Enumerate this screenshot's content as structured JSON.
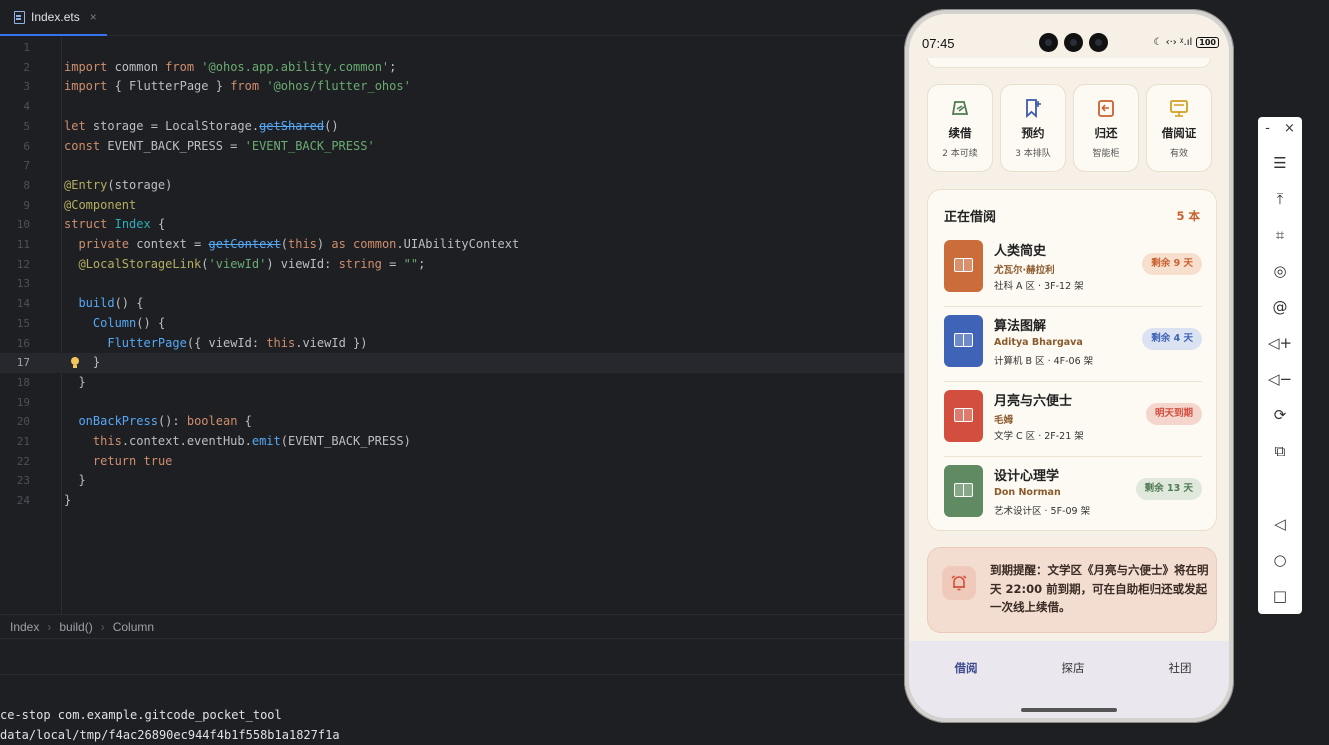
{
  "editor": {
    "tab_label": "Index.ets",
    "tab_close": "×",
    "current_line": 17,
    "lines": [
      {
        "n": "1",
        "html": ""
      },
      {
        "n": "2",
        "html": "<span class='kw'>import</span> common <span class='kw'>from</span> <span class='str'>'@ohos.app.ability.common'</span>;"
      },
      {
        "n": "3",
        "html": "<span class='kw'>import</span> { FlutterPage } <span class='kw'>from</span> <span class='str'>'@ohos/flutter_ohos'</span>"
      },
      {
        "n": "4",
        "html": ""
      },
      {
        "n": "5",
        "html": "<span class='kw'>let</span> storage = LocalStorage.<span class='dep'>getShared</span>()"
      },
      {
        "n": "6",
        "html": "<span class='kw'>const</span> EVENT_BACK_PRESS = <span class='str'>'EVENT_BACK_PRESS'</span>"
      },
      {
        "n": "7",
        "html": ""
      },
      {
        "n": "8",
        "html": "<span class='an'>@Entry</span>(storage)"
      },
      {
        "n": "9",
        "html": "<span class='an'>@Component</span>"
      },
      {
        "n": "10",
        "html": "<span class='kw'>struct</span> <span class='ty'>Index</span> {"
      },
      {
        "n": "11",
        "html": "  <span class='kw'>private</span> context = <span class='dep'>getContext</span>(<span class='kw'>this</span>) <span class='kw'>as</span> <span class='kw'>common</span>.UIAbilityContext"
      },
      {
        "n": "12",
        "html": "  <span class='an'>@LocalStorageLink</span>(<span class='str'>'viewId'</span>) viewId: <span class='kw'>string</span> = <span class='str'>\"\"</span>;"
      },
      {
        "n": "13",
        "html": ""
      },
      {
        "n": "14",
        "html": "  <span class='fn'>build</span>() {"
      },
      {
        "n": "15",
        "html": "    <span class='fn'>Column</span>() {"
      },
      {
        "n": "16",
        "html": "      <span class='fn'>FlutterPage</span>({ viewId: <span class='kw'>this</span>.viewId })"
      },
      {
        "n": "17",
        "html": "    }"
      },
      {
        "n": "18",
        "html": "  }"
      },
      {
        "n": "19",
        "html": ""
      },
      {
        "n": "20",
        "html": "  <span class='fn'>onBackPress</span>(): <span class='kw'>boolean</span> {"
      },
      {
        "n": "21",
        "html": "    <span class='kw'>this</span>.context.eventHub.<span class='fn'>emit</span>(EVENT_BACK_PRESS)"
      },
      {
        "n": "22",
        "html": "    <span class='kw'>return</span> <span class='kw'>true</span>"
      },
      {
        "n": "23",
        "html": "  }"
      },
      {
        "n": "24",
        "html": "}"
      }
    ],
    "breadcrumb": [
      "Index",
      "build()",
      "Column"
    ],
    "console": [
      "ce-stop com.example.gitcode_pocket_tool",
      "data/local/tmp/f4ac26890ec944f4b1f558b1a1827f1a"
    ]
  },
  "phone": {
    "status": {
      "time": "07:45",
      "battery": "100",
      "icons": "☾ ‹·› ᵡ.ıl"
    },
    "tiles": [
      {
        "title": "续借",
        "sub": "2 本可续",
        "icon": "renew-icon",
        "color": "#4f7a55"
      },
      {
        "title": "预约",
        "sub": "3 本排队",
        "icon": "reserve-icon",
        "color": "#3d59a8"
      },
      {
        "title": "归还",
        "sub": "智能柜",
        "icon": "return-icon",
        "color": "#c9612f"
      },
      {
        "title": "借阅证",
        "sub": "有效",
        "icon": "card-icon",
        "color": "#d1a021"
      }
    ],
    "borrowing": {
      "title": "正在借阅",
      "count": "5 本",
      "books": [
        {
          "title": "人类简史",
          "author": "尤瓦尔·赫拉利",
          "location": "社科 A 区 · 3F-12 架",
          "badge": "剩余 9 天",
          "cover": "#cb6d3b",
          "badge_bg": "#f6dfcc",
          "badge_fg": "#c9612f"
        },
        {
          "title": "算法图解",
          "author": "Aditya Bhargava",
          "location": "计算机 B 区 · 4F-06 架",
          "badge": "剩余 4 天",
          "cover": "#3e63b7",
          "badge_bg": "#dbe3f2",
          "badge_fg": "#3e63b7"
        },
        {
          "title": "月亮与六便士",
          "author": "毛姆",
          "location": "文学 C 区 · 2F-21 架",
          "badge": "明天到期",
          "cover": "#d24f3f",
          "badge_bg": "#f5d6cd",
          "badge_fg": "#d24f3f"
        },
        {
          "title": "设计心理学",
          "author": "Don Norman",
          "location": "艺术设计区 · 5F-09 架",
          "badge": "剩余 13 天",
          "cover": "#5f8a62",
          "badge_bg": "#dfe8da",
          "badge_fg": "#4f7a55"
        }
      ]
    },
    "reminder": {
      "text": "到期提醒：文学区《月亮与六便士》将在明天 22:00 前到期，可在自助柜归还或发起一次线上续借。"
    },
    "nav": [
      "借阅",
      "探店",
      "社团"
    ]
  },
  "emulator": {
    "top": [
      "-",
      "×"
    ],
    "buttons": [
      {
        "name": "menu-icon",
        "glyph": "☰"
      },
      {
        "name": "pin-top-icon",
        "glyph": "⤒"
      },
      {
        "name": "crop-icon",
        "glyph": "⌗"
      },
      {
        "name": "rotate-icon",
        "glyph": "◎"
      },
      {
        "name": "location-icon",
        "glyph": "@"
      },
      {
        "name": "volume-up-icon",
        "glyph": "◁+"
      },
      {
        "name": "volume-down-icon",
        "glyph": "◁−"
      },
      {
        "name": "power-icon",
        "glyph": "⟳"
      },
      {
        "name": "multi-device-icon",
        "glyph": "⧉"
      },
      {
        "name": "back-icon",
        "glyph": "◁"
      },
      {
        "name": "home-icon",
        "glyph": "○"
      },
      {
        "name": "recents-icon",
        "glyph": "□"
      }
    ]
  }
}
